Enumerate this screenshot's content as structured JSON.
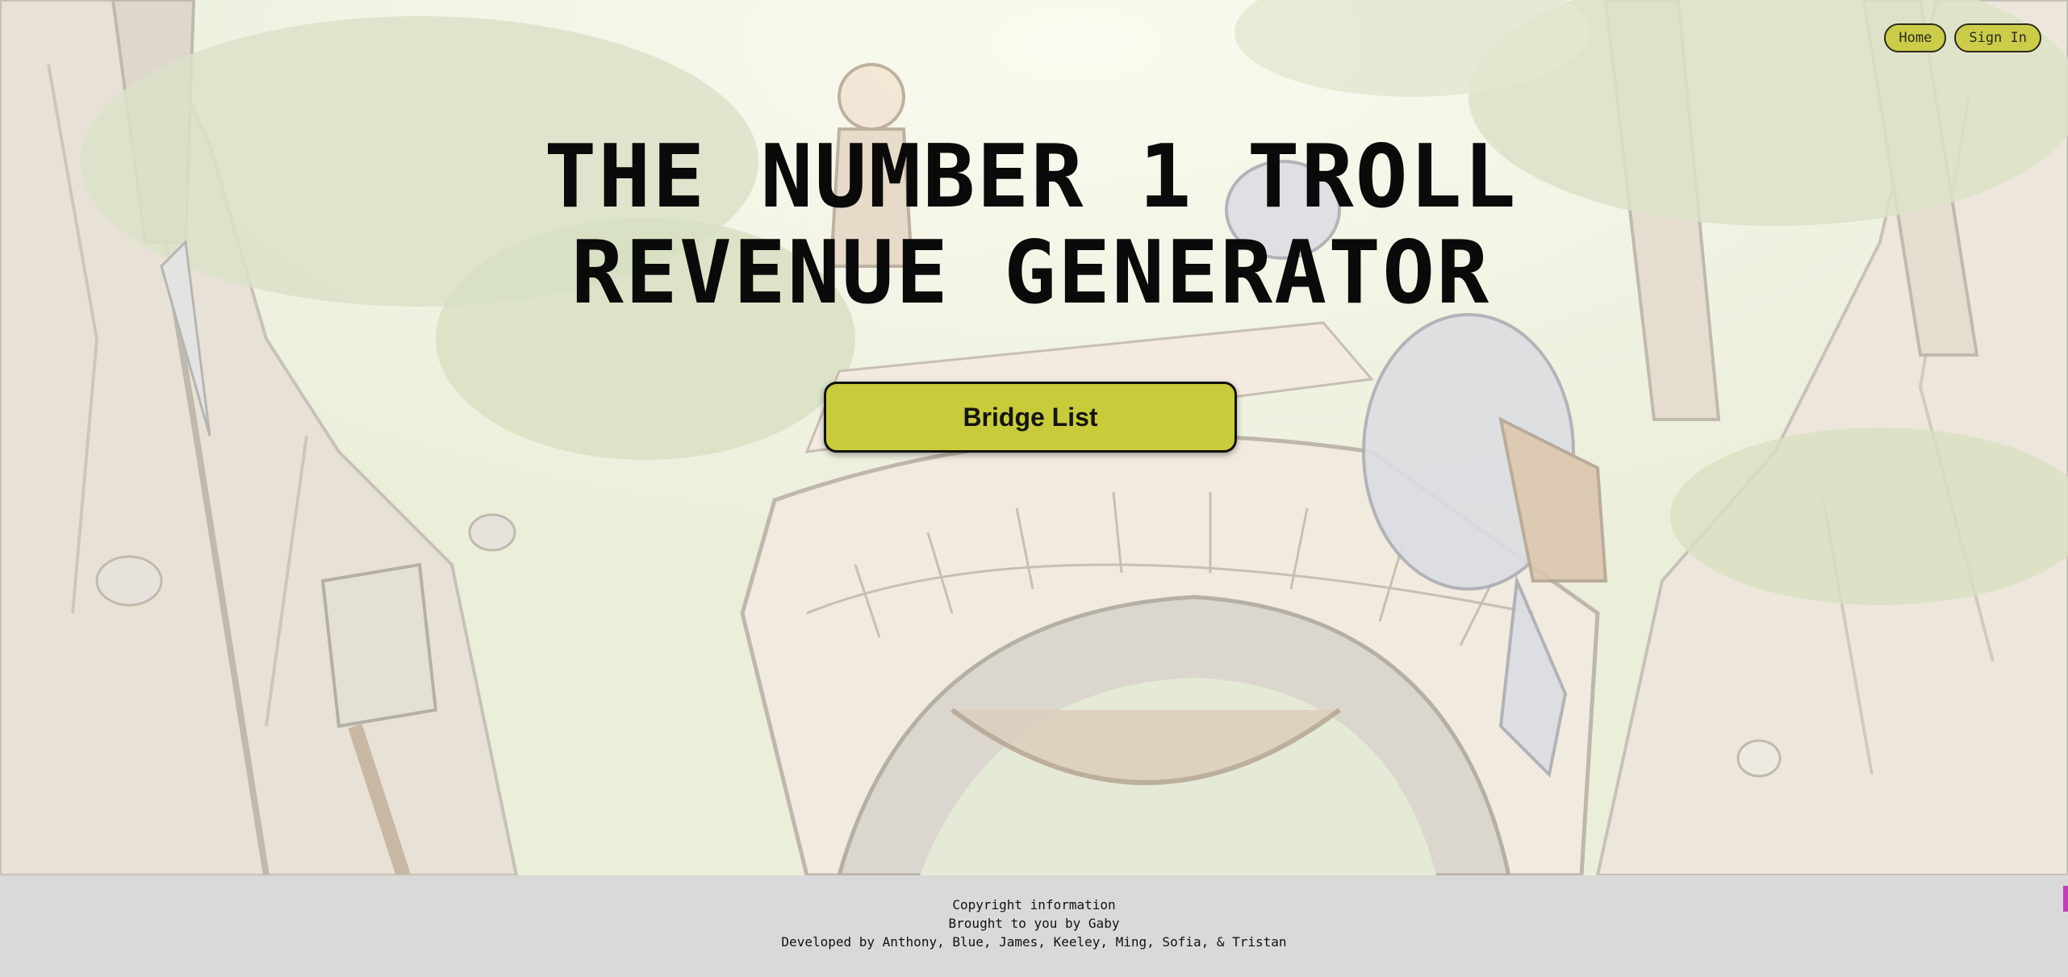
{
  "nav": {
    "home_label": "Home",
    "signin_label": "Sign In"
  },
  "hero": {
    "title_line1": "THE NUMBER 1 TROLL",
    "title_line2": "REVENUE GENERATOR",
    "cta_label": "Bridge List"
  },
  "footer": {
    "copyright": "Copyright information",
    "brought_by": "Brought to you by Gaby",
    "developers": "Developed by Anthony, Blue, James, Keeley, Ming, Sofia, & Tristan"
  },
  "colors": {
    "accent": "#c9cc3a",
    "footer_bg": "#d9d9d9",
    "text": "#0a0a0a"
  },
  "background": {
    "icon": "troll-bridge-forest-illustration"
  }
}
